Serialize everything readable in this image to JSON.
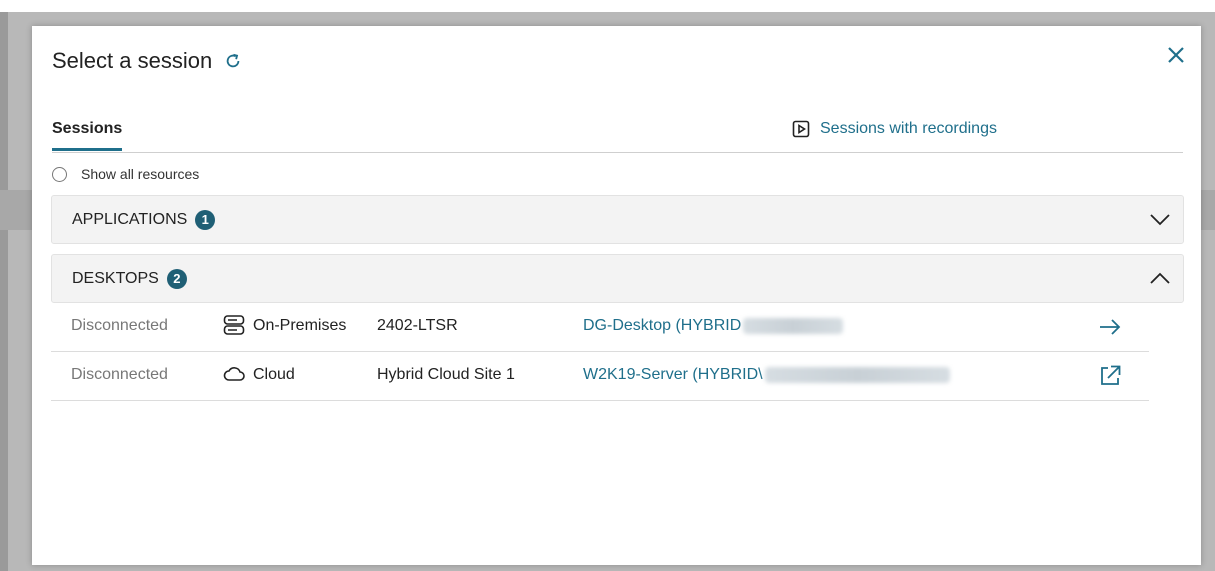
{
  "dialog": {
    "title": "Select a session",
    "tabs": {
      "sessions": "Sessions",
      "recordings": "Sessions with recordings"
    },
    "show_all": "Show all resources",
    "sections": [
      {
        "label": "APPLICATIONS",
        "count": "1",
        "expanded": false
      },
      {
        "label": "DESKTOPS",
        "count": "2",
        "expanded": true
      }
    ],
    "rows": [
      {
        "status": "Disconnected",
        "location": "On-Premises",
        "location_icon": "server-icon",
        "site": "2402-LTSR",
        "name": "DG-Desktop (HYBRID",
        "action_icon": "arrow-right-icon"
      },
      {
        "status": "Disconnected",
        "location": "Cloud",
        "location_icon": "cloud-icon",
        "site": "Hybrid Cloud Site 1",
        "name": "W2K19-Server (HYBRID\\",
        "action_icon": "external-link-icon"
      }
    ]
  },
  "colors": {
    "accent": "#1f6f8b",
    "badge": "#1f5f75"
  }
}
